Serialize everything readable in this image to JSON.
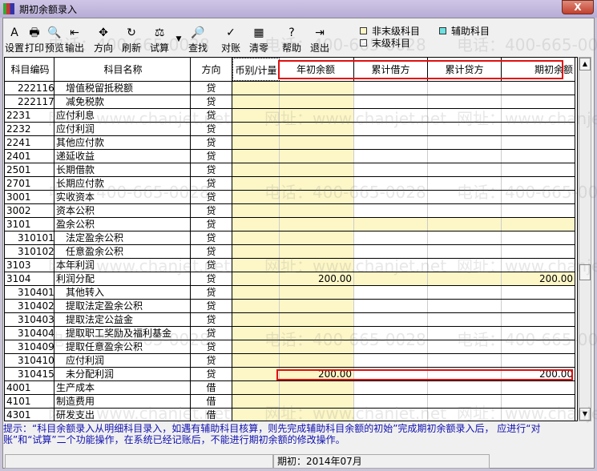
{
  "window": {
    "title": "期初余额录入",
    "close": "X"
  },
  "toolbar": [
    {
      "label": "设置",
      "icon": "settings-icon",
      "g": "A"
    },
    {
      "label": "打印",
      "icon": "print-icon",
      "g": "🖶"
    },
    {
      "label": "预览",
      "icon": "preview-icon",
      "g": "🔍"
    },
    {
      "label": "输出",
      "icon": "export-icon",
      "g": "⇤"
    },
    {
      "label": "方向",
      "icon": "direction-icon",
      "g": "✥"
    },
    {
      "label": "刷新",
      "icon": "refresh-icon",
      "g": "↻"
    },
    {
      "label": "试算",
      "icon": "balance-icon",
      "g": "⚖"
    },
    {
      "label": "查找",
      "icon": "find-icon",
      "g": "🔎"
    },
    {
      "label": "对账",
      "icon": "reconcile-icon",
      "g": "✓"
    },
    {
      "label": "清零",
      "icon": "clear-icon",
      "g": "▦"
    },
    {
      "label": "帮助",
      "icon": "help-icon",
      "g": "?"
    },
    {
      "label": "退出",
      "icon": "exit-icon",
      "g": "⇥"
    }
  ],
  "legend": {
    "non_leaf": "非末级科目",
    "auxiliary": "辅助科目",
    "leaf": "末级科目"
  },
  "colors": {
    "non_leaf": "#fdf7c7",
    "auxiliary": "#6fe0e0",
    "leaf": "#ffffff",
    "highlight": "#e01010",
    "hint": "#1010b0"
  },
  "columns": [
    "科目编码",
    "科目名称",
    "方向",
    "币别/计量",
    "年初余额",
    "累计借方",
    "累计贷方",
    "期初余额"
  ],
  "rows": [
    {
      "code": "222116",
      "name": "增值税留抵税额",
      "dir": "贷",
      "indent": true
    },
    {
      "code": "222117",
      "name": "减免税款",
      "dir": "贷",
      "indent": true
    },
    {
      "code": "2231",
      "name": "应付利息",
      "dir": "贷"
    },
    {
      "code": "2232",
      "name": "应付利润",
      "dir": "贷"
    },
    {
      "code": "2241",
      "name": "其他应付款",
      "dir": "贷"
    },
    {
      "code": "2401",
      "name": "递延收益",
      "dir": "贷"
    },
    {
      "code": "2501",
      "name": "长期借款",
      "dir": "贷"
    },
    {
      "code": "2701",
      "name": "长期应付款",
      "dir": "贷"
    },
    {
      "code": "3001",
      "name": "实收资本",
      "dir": "贷"
    },
    {
      "code": "3002",
      "name": "资本公积",
      "dir": "贷"
    },
    {
      "code": "3101",
      "name": "盈余公积",
      "dir": "贷",
      "parent": true
    },
    {
      "code": "310101",
      "name": "法定盈余公积",
      "dir": "贷",
      "indent": true
    },
    {
      "code": "310102",
      "name": "任意盈余公积",
      "dir": "贷",
      "indent": true
    },
    {
      "code": "3103",
      "name": "本年利润",
      "dir": "贷"
    },
    {
      "code": "3104",
      "name": "利润分配",
      "dir": "贷",
      "parent": true,
      "start": "200.00",
      "end": "200.00"
    },
    {
      "code": "310401",
      "name": "其他转入",
      "dir": "贷",
      "indent": true
    },
    {
      "code": "310402",
      "name": "提取法定盈余公积",
      "dir": "贷",
      "indent": true
    },
    {
      "code": "310403",
      "name": "提取法定公益金",
      "dir": "贷",
      "indent": true
    },
    {
      "code": "310404",
      "name": "提取职工奖励及福利基金",
      "dir": "贷",
      "indent": true
    },
    {
      "code": "310409",
      "name": "提取任意盈余公积",
      "dir": "贷",
      "indent": true
    },
    {
      "code": "310410",
      "name": "应付利润",
      "dir": "贷",
      "indent": true
    },
    {
      "code": "310415",
      "name": "未分配利润",
      "dir": "贷",
      "indent": true,
      "start": "200.00",
      "end": "200.00"
    },
    {
      "code": "4001",
      "name": "生产成本",
      "dir": "借"
    },
    {
      "code": "4101",
      "name": "制造费用",
      "dir": "借"
    },
    {
      "code": "4301",
      "name": "研发支出",
      "dir": "借"
    }
  ],
  "hint": "提示：“科目余额录入从明细科目录入，如遇有辅助科目核算，则先完成辅助科目余额的初始”完成期初余额录入后，        应进行“对账”和“试算”二个功能操作，在系统已经记账后，不能进行期初余额的修改操作。",
  "status": {
    "period": "期初：2014年07月"
  },
  "watermark": [
    "电话：400-665-0028",
    "网址：www.chanjet.net"
  ]
}
